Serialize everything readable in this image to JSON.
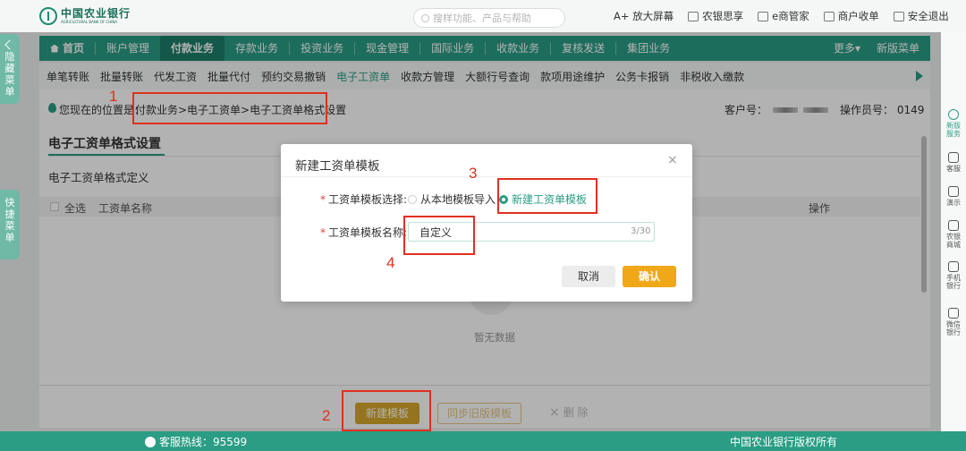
{
  "header": {
    "logo_cn": "中国农业银行",
    "logo_en": "AGRICULTURAL BANK OF CHINA",
    "search_placeholder": "搜样功能、产品与帮助",
    "links": [
      {
        "label": "A+ 放大屏幕",
        "icon": "zoom-icon"
      },
      {
        "label": "农银思享",
        "icon": "share-icon"
      },
      {
        "label": "e商管家",
        "icon": "e-business-icon"
      },
      {
        "label": "商户收单",
        "icon": "merchant-icon"
      },
      {
        "label": "安全退出",
        "icon": "logout-icon"
      }
    ]
  },
  "mainnav": {
    "items": [
      "首页",
      "账户管理",
      "付款业务",
      "存款业务",
      "投资业务",
      "现金管理",
      "国际业务",
      "收款业务",
      "复核发送",
      "集团业务"
    ],
    "active_index": 2,
    "more": "更多▾",
    "new_menu": "新版菜单"
  },
  "subnav": {
    "items": [
      "单笔转账",
      "批量转账",
      "代发工资",
      "批量代付",
      "预约交易撤销",
      "电子工资单",
      "收款方管理",
      "大额行号查询",
      "款项用途维护",
      "公务卡报销",
      "非税收入缴款"
    ],
    "active_index": 5
  },
  "location": {
    "label": "您现在的位置是：",
    "path": "付款业务>电子工资单>电子工资单格式设置",
    "customer_label": "客户号：",
    "operator_label": "操作员号：",
    "operator_id": "0149"
  },
  "content": {
    "page_title": "电子工资单格式设置",
    "section_title": "电子工资单格式定义",
    "table_headers": {
      "select_all": "全选",
      "name": "工资单名称",
      "ops": "操作"
    },
    "empty_text": "暂无数据"
  },
  "buttons": {
    "new_template": "新建模板",
    "sync_old": "同步旧版模板",
    "delete": "删 除"
  },
  "footer": {
    "hotline": "客服热线：95599",
    "copyright": "中国农业银行版权所有"
  },
  "modal": {
    "title": "新建工资单模板",
    "select_label": "工资单模板选择:",
    "option_local": "从本地模板导入",
    "option_new": "新建工资单模板",
    "selected": "option_new",
    "name_label": "工资单模板名称:",
    "name_value": "自定义",
    "counter": "3/30",
    "cancel": "取消",
    "confirm": "确认",
    "close": "×"
  },
  "side": {
    "hide_menu": "隐藏菜单",
    "quick_menu": "快捷菜单"
  },
  "rail": [
    {
      "label": "新版服务",
      "icon": "new-service-icon"
    },
    {
      "label": "客服",
      "icon": "headset-icon"
    },
    {
      "label": "演示",
      "icon": "play-icon"
    },
    {
      "label": "农银商城",
      "icon": "mall-icon"
    },
    {
      "label": "手机银行",
      "icon": "qrcode-icon"
    },
    {
      "label": "微信银行",
      "icon": "wechat-icon"
    }
  ],
  "annotations": [
    "1",
    "2",
    "3",
    "4"
  ],
  "colors": {
    "primary": "#2a9d84",
    "accent": "#f0a818",
    "annotation": "#e03020"
  }
}
